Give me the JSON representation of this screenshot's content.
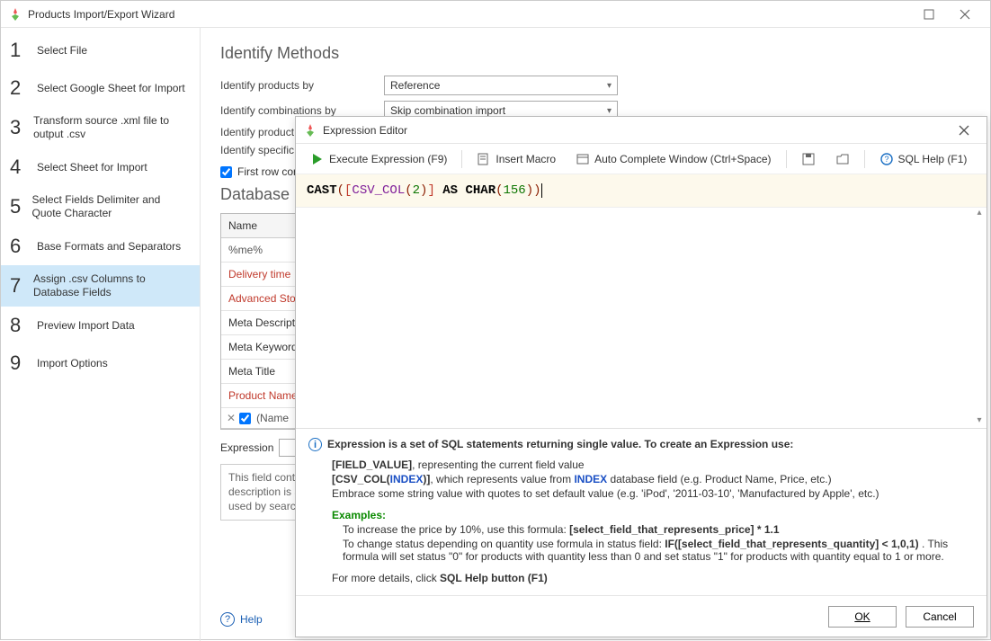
{
  "window": {
    "title": "Products Import/Export Wizard",
    "maximize_icon": "maximize",
    "close_icon": "close"
  },
  "sidebar": {
    "steps": [
      {
        "num": "1",
        "label": "Select File"
      },
      {
        "num": "2",
        "label": "Select Google Sheet for Import"
      },
      {
        "num": "3",
        "label": "Transform source .xml file to output .csv"
      },
      {
        "num": "4",
        "label": "Select Sheet for Import"
      },
      {
        "num": "5",
        "label": "Select Fields Delimiter and Quote Character"
      },
      {
        "num": "6",
        "label": "Base Formats and Separators"
      },
      {
        "num": "7",
        "label": "Assign .csv Columns to Database Fields"
      },
      {
        "num": "8",
        "label": "Preview Import Data"
      },
      {
        "num": "9",
        "label": "Import Options"
      }
    ],
    "active_index": 6
  },
  "content": {
    "heading1": "Identify Methods",
    "rows": [
      {
        "label": "Identify products by",
        "value": "Reference"
      },
      {
        "label": "Identify combinations by",
        "value": "Skip combination import"
      }
    ],
    "row_partial1": "Identify product",
    "row_partial2": "Identify specific",
    "first_row_checkbox_label": "First row con",
    "first_row_checked": true,
    "heading2": "Database F",
    "grid_header": "Name",
    "filter_text": "%me%",
    "grid_rows": [
      {
        "name": "Delivery time",
        "red": true
      },
      {
        "name": "Advanced Stock",
        "red": true
      },
      {
        "name": "Meta Description",
        "red": false
      },
      {
        "name": "Meta Keywords",
        "red": false
      },
      {
        "name": "Meta Title",
        "red": false
      },
      {
        "name": "Product Name",
        "red": true
      }
    ],
    "filter_row_text": "(Name",
    "expression_label": "Expression",
    "desc_text": "This field contai\ndescription is a\nused by search",
    "help_label": "Help"
  },
  "dialog": {
    "title": "Expression Editor",
    "toolbar": {
      "execute": "Execute Expression (F9)",
      "insert_macro": "Insert Macro",
      "autocomplete": "Auto Complete Window (Ctrl+Space)",
      "sql_help": "SQL Help (F1)"
    },
    "expression": {
      "cast": "CAST",
      "csv_col": "CSV_COL",
      "arg_idx": "2",
      "as": "AS",
      "char": "CHAR",
      "char_arg": "156"
    },
    "help": {
      "lead": "Expression is a set of SQL statements returning single value. To create an Expression use:",
      "l1a": "[FIELD_VALUE]",
      "l1b": ", representing the current field value",
      "l2a": "[CSV_COL(",
      "l2b": "INDEX",
      "l2c": ")]",
      "l2d": ", which represents value from ",
      "l2e": "INDEX",
      "l2f": " database field (e.g. Product Name, Price, etc.)",
      "l3": "Embrace some string value with quotes to set default value (e.g. 'iPod', '2011-03-10', 'Manufactured by Apple', etc.)",
      "ex_label": "Examples:",
      "ex1a": "To increase the price by 10%, use this formula: ",
      "ex1b": "[select_field_that_represents_price] * 1.1",
      "ex2a": "To change status depending on quantity use formula in status field: ",
      "ex2b": "IF([select_field_that_represents_quantity] < 1,0,1)",
      "ex2c": " . This formula will set status \"0\" for products with quantity less than 0 and set status \"1\" for products with quantity equal to 1 or more.",
      "more": "For more details, click ",
      "more_b": "SQL Help button (F1)"
    },
    "buttons": {
      "ok": "OK",
      "cancel": "Cancel"
    }
  }
}
